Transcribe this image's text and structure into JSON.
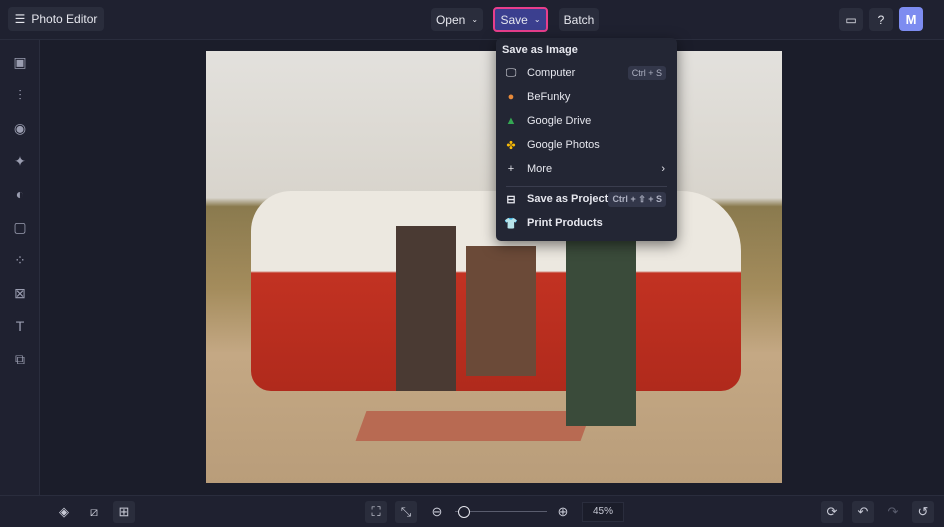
{
  "header": {
    "app_title": "Photo Editor",
    "open": "Open",
    "save": "Save",
    "batch": "Batch",
    "avatar": "M"
  },
  "save_menu": {
    "heading": "Save as Image",
    "items": [
      {
        "label": "Computer",
        "shortcut": "Ctrl + S",
        "icon": "monitor-icon"
      },
      {
        "label": "BeFunky",
        "icon": "befunky-icon"
      },
      {
        "label": "Google Drive",
        "icon": "google-drive-icon"
      },
      {
        "label": "Google Photos",
        "icon": "google-photos-icon"
      },
      {
        "label": "More",
        "icon": "plus-icon"
      }
    ],
    "project": {
      "label": "Save as Project",
      "shortcut": "Ctrl + ⇧ + S"
    },
    "print": {
      "label": "Print Products"
    }
  },
  "footer": {
    "zoom": "45%",
    "zoom_fraction": 0.05
  },
  "colors": {
    "accent": "#e83e8c",
    "save_bg": "#3b3f8f"
  }
}
